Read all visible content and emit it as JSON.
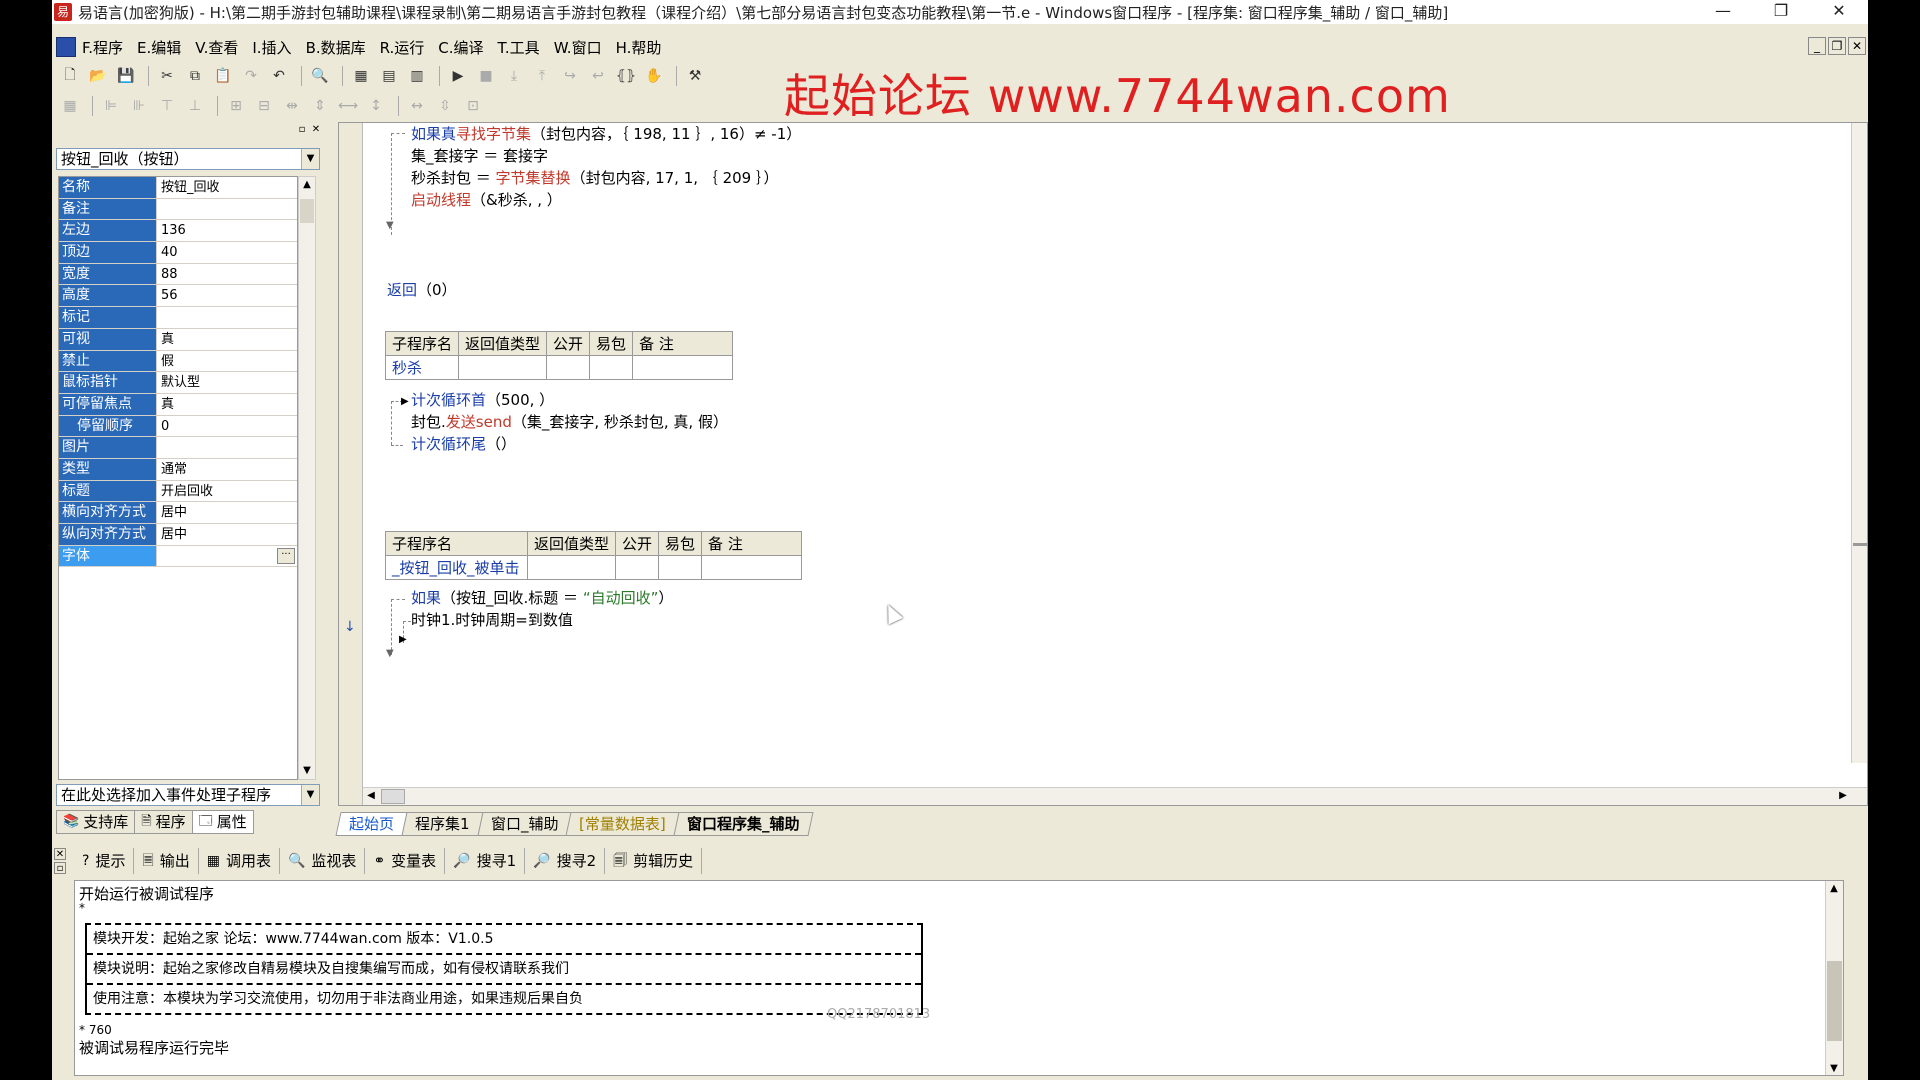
{
  "window": {
    "title": "易语言(加密狗版) - H:\\第二期手游封包辅助课程\\课程录制\\第二期易语言手游封包教程（课程介绍）\\第七部分易语言封包变态功能教程\\第一节.e - Windows窗口程序 - [程序集: 窗口程序集_辅助 / 窗口_辅助]",
    "minimize": "—",
    "restore": "❐",
    "close": "✕"
  },
  "menu": {
    "items": [
      "F.程序",
      "E.编辑",
      "V.查看",
      "I.插入",
      "B.数据库",
      "R.运行",
      "C.编译",
      "T.工具",
      "W.窗口",
      "H.帮助"
    ]
  },
  "watermark": "起始论坛 www.7744wan.com",
  "left_panel": {
    "object_select": "按钮_回收（按钮）",
    "properties": [
      {
        "name": "名称",
        "value": "按钮_回收"
      },
      {
        "name": "备注",
        "value": ""
      },
      {
        "name": "左边",
        "value": "136"
      },
      {
        "name": "顶边",
        "value": "40"
      },
      {
        "name": "宽度",
        "value": "88"
      },
      {
        "name": "高度",
        "value": "56"
      },
      {
        "name": "标记",
        "value": ""
      },
      {
        "name": "可视",
        "value": "真"
      },
      {
        "name": "禁止",
        "value": "假"
      },
      {
        "name": "鼠标指针",
        "value": "默认型"
      },
      {
        "name": "可停留焦点",
        "value": "真"
      },
      {
        "name": "停留顺序",
        "value": "0"
      },
      {
        "name": "图片",
        "value": ""
      },
      {
        "name": "类型",
        "value": "通常"
      },
      {
        "name": "标题",
        "value": "开启回收"
      },
      {
        "name": "横向对齐方式",
        "value": "居中"
      },
      {
        "name": "纵向对齐方式",
        "value": "居中"
      },
      {
        "name": "字体",
        "value": ""
      }
    ],
    "event_select": "在此处选择加入事件处理子程序",
    "tabs": [
      "支持库",
      "程序",
      "属性"
    ]
  },
  "editor": {
    "line1_kw": "如果真",
    "line1_fn": "寻找字节集",
    "line1_rest": "（封包内容，｛ 198, 11 ｝, 16）≠ -1）",
    "line2": "集_套接字 ＝ 套接字",
    "line3_a": "秒杀封包 ＝ ",
    "line3_fn": "字节集替换",
    "line3_rest": "（封包内容, 17, 1, ｛ 209 ｝）",
    "line4_fn": "启动线程",
    "line4_rest": "（&秒杀, , ）",
    "return_kw": "返回",
    "return_rest": "（0）",
    "table_headers_1": [
      "子程序名",
      "返回值类型",
      "公开",
      "易包",
      "备 注"
    ],
    "table1_name": "秒杀",
    "loop_start_kw": "计次循环首",
    "loop_start_rest": "（500, ）",
    "send_a": "封包.",
    "send_fn": "发送send",
    "send_rest": "（集_套接字, 秒杀封包, 真, 假）",
    "loop_end_kw": "计次循环尾",
    "loop_end_rest": "（）",
    "table2_name": "_按钮_回收_被单击",
    "if_kw": "如果",
    "if_rest": "（按钮_回收.标题 ＝ ",
    "if_str": "“自动回收”",
    "if_end": "）",
    "timer_line": "时钟1.时钟周期=到数值"
  },
  "editor_tabs": [
    "起始页",
    "程序集1",
    "窗口_辅助",
    "[常量数据表]",
    "窗口程序集_辅助"
  ],
  "bottom_tabs": [
    "提示",
    "输出",
    "调用表",
    "监视表",
    "变量表",
    "搜寻1",
    "搜寻2",
    "剪辑历史"
  ],
  "output": {
    "line_start": "开始运行被调试程序",
    "star1": "*",
    "info_rows": [
      "模块开发：起始之家  论坛：www.7744wan.com  版本：V1.0.5",
      "模块说明：起始之家修改自精易模块及自搜集编写而成，如有侵权请联系我们",
      "使用注意：本模块为学习交流使用，切勿用于非法商业用途，如果违规后果自负"
    ],
    "qq": "QQ2178701813",
    "star_num": "* 760",
    "line_end": "被调试易程序运行完毕"
  }
}
